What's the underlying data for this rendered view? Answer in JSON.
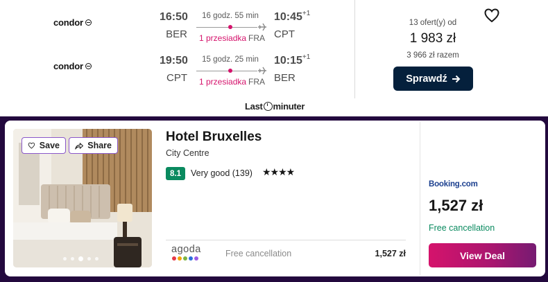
{
  "flight": {
    "legs": [
      {
        "airline": "condor",
        "dep_time": "16:50",
        "dep_code": "BER",
        "duration": "16 godz. 55 min",
        "stops": "1 przesiadka",
        "via": "FRA",
        "arr_time": "10:45",
        "arr_day_offset": "+1",
        "arr_code": "CPT"
      },
      {
        "airline": "condor",
        "dep_time": "19:50",
        "dep_code": "CPT",
        "duration": "15 godz. 25 min",
        "stops": "1 przesiadka",
        "via": "FRA",
        "arr_time": "10:15",
        "arr_day_offset": "+1",
        "arr_code": "BER"
      }
    ],
    "offers_count": "13 ofert(y) od",
    "price": "1 983 zł",
    "price_total": "3 966 zł razem",
    "check_button": "Sprawdź",
    "provider_pre": "Last",
    "provider_post": "minuter",
    "save_icon": "heart-icon"
  },
  "hotel": {
    "save_label": "Save",
    "share_label": "Share",
    "name": "Hotel Bruxelles",
    "area": "City Centre",
    "score": "8.1",
    "score_text": "Very good (139)",
    "stars": "★★★★",
    "photo_dots": 5,
    "photo_active_dot": 3,
    "offer": {
      "provider": "agoda",
      "cancellation": "Free cancellation",
      "price": "1,527 zł",
      "agoda_dot_colors": [
        "#e63946",
        "#f4a300",
        "#7cb342",
        "#2a6fdb",
        "#9b5de5"
      ]
    },
    "best_offer": {
      "provider": "Booking.com",
      "price": "1,527 zł",
      "cancellation": "Free cancellation",
      "button": "View Deal"
    }
  },
  "colors": {
    "accent_pink": "#d5136c",
    "navy_button": "#05203c",
    "band_purple": "#23093e",
    "score_green": "#0a8a5f"
  }
}
